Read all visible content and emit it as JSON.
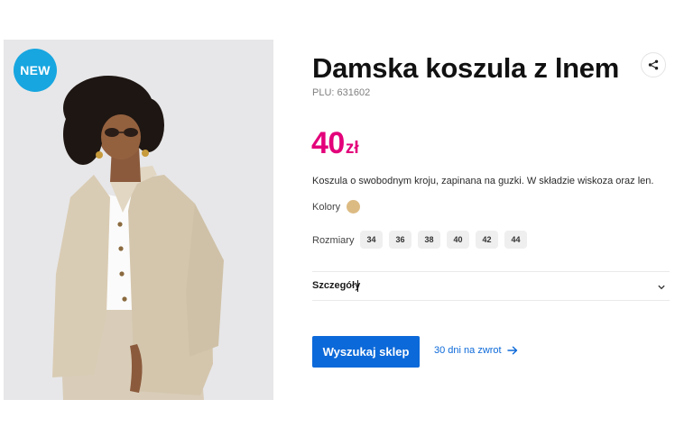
{
  "product": {
    "badge": "NEW",
    "title": "Damska koszula z lnem",
    "plu": "PLU: 631602",
    "price_value": "40",
    "price_currency": "zł",
    "description": "Koszula o swobodnym kroju, zapinana na guzki. W składzie wiskoza oraz len."
  },
  "colors": {
    "label": "Kolory",
    "swatches": [
      {
        "name": "beige",
        "hex": "#dcbb83"
      }
    ]
  },
  "sizes": {
    "label": "Rozmiary",
    "options": [
      "34",
      "36",
      "38",
      "40",
      "42",
      "44"
    ]
  },
  "details": {
    "label": "Szczegóły"
  },
  "actions": {
    "store_button": "Wyszukaj sklep",
    "returns_link": "30 dni na zwrot"
  },
  "icons": {
    "share": "share-icon",
    "chevron": "chevron-down-icon",
    "arrow": "arrow-right-icon"
  },
  "theme": {
    "badge_color": "#17a6e0",
    "price_color": "#e3007a",
    "primary_color": "#0c69d9"
  }
}
